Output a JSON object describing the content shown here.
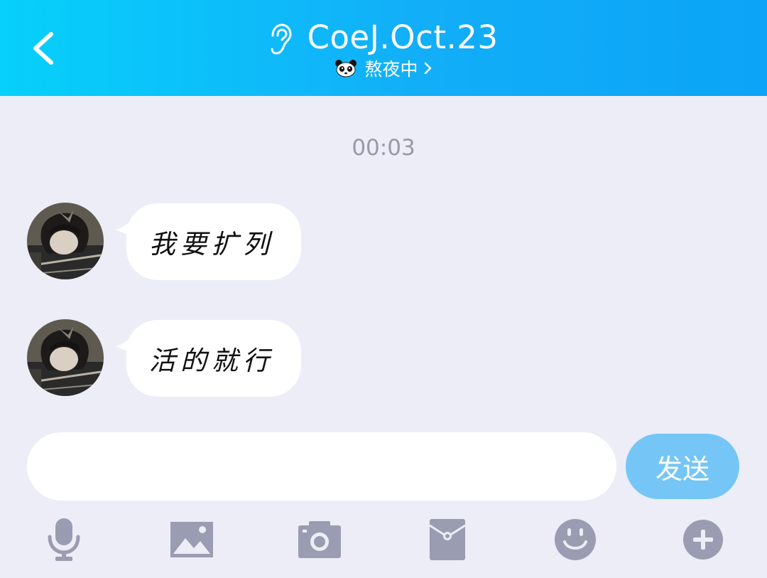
{
  "header": {
    "title": "CoeJ.Oct.23",
    "status": "熬夜中",
    "background_start": "#06d0fb",
    "background_end": "#0ba4f7"
  },
  "chat": {
    "timestamp": "00:03",
    "messages": [
      {
        "sender": "contact",
        "text": "我要扩列"
      },
      {
        "sender": "contact",
        "text": "活的就行"
      }
    ]
  },
  "composer": {
    "input_value": "",
    "send_label": "发送",
    "send_color": "#75c6f6"
  },
  "toolbar": {
    "icons": [
      "microphone-icon",
      "image-icon",
      "camera-icon",
      "red-packet-icon",
      "emoji-icon",
      "plus-icon"
    ],
    "icon_color": "#9a9db1"
  }
}
